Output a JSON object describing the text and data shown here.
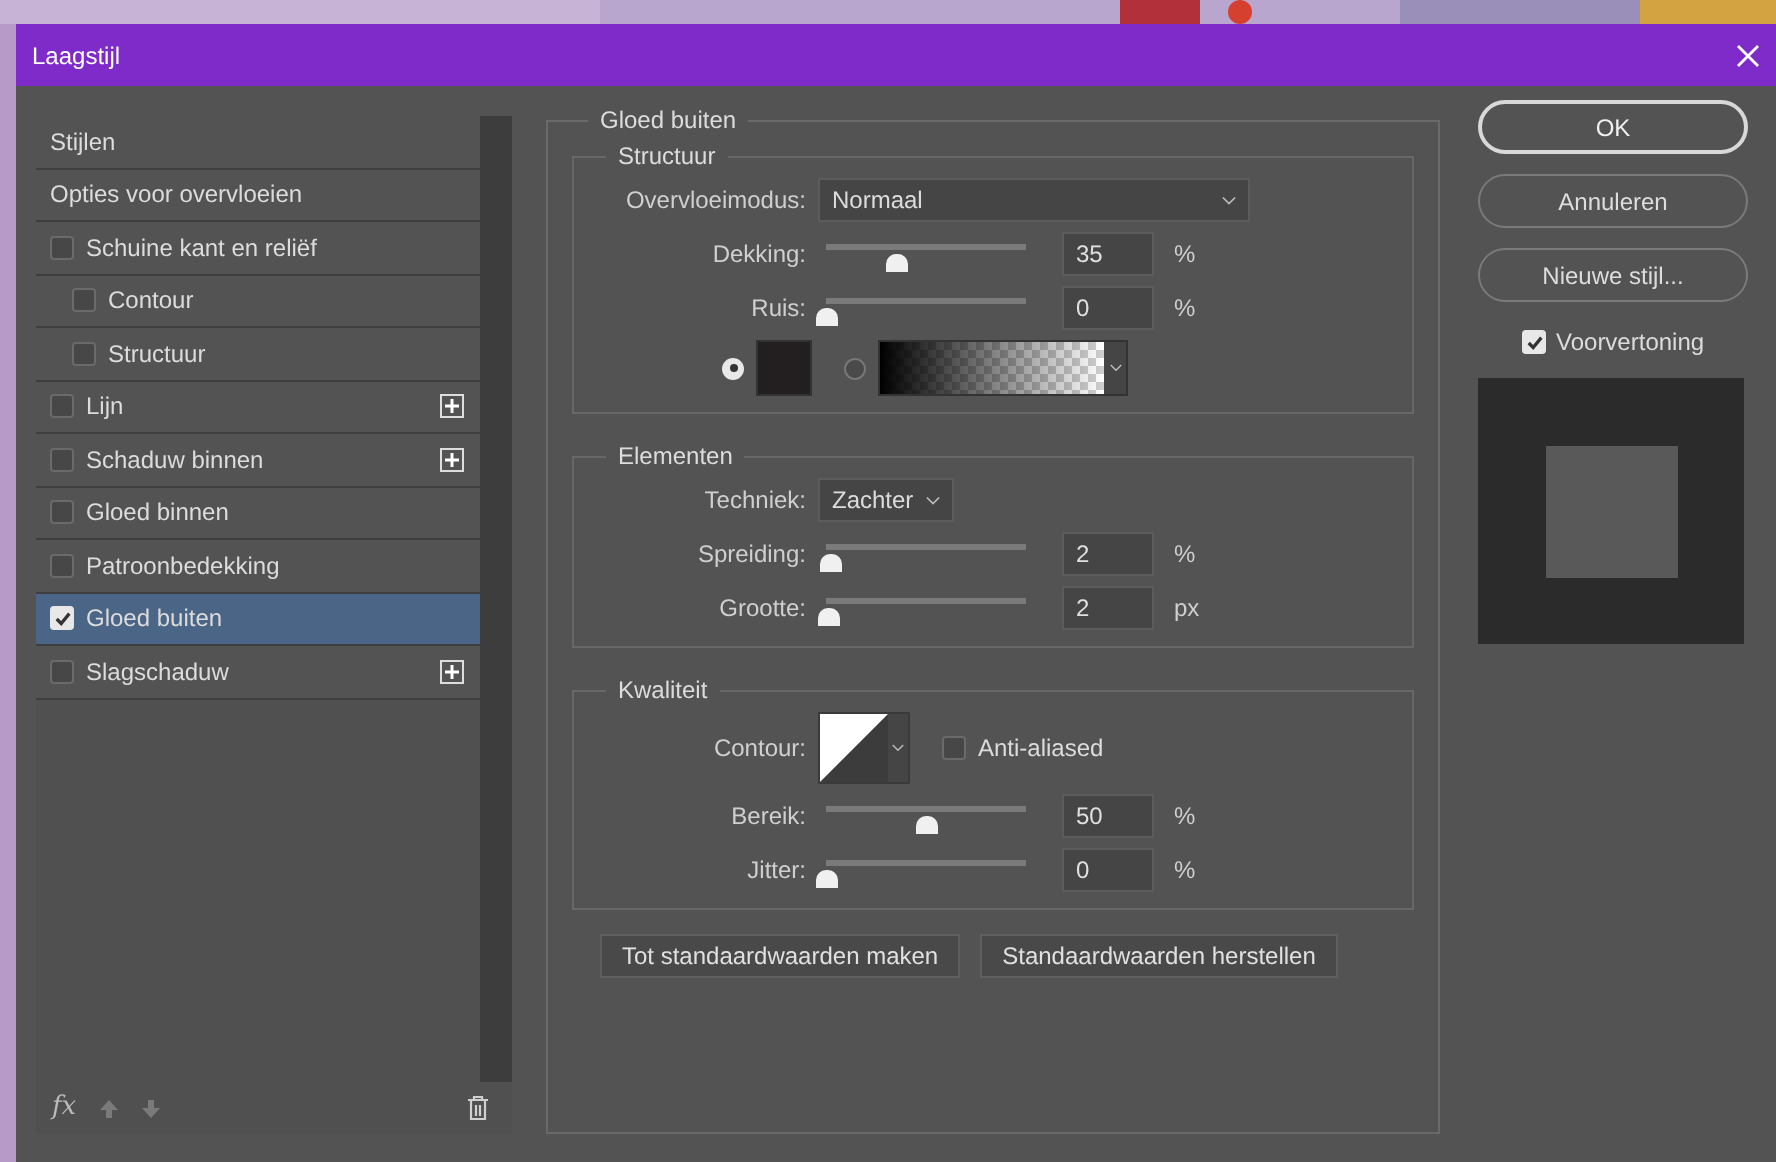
{
  "window": {
    "title": "Laagstijl"
  },
  "sidebar": {
    "items": [
      {
        "label": "Stijlen",
        "kind": "header",
        "selected": false
      },
      {
        "label": "Opties voor overvloeien",
        "kind": "header",
        "selected": false
      },
      {
        "label": "Schuine kant en reliëf",
        "kind": "checkbox",
        "checked": false,
        "selected": false,
        "add_button": false,
        "children": [
          {
            "label": "Contour",
            "kind": "checkbox",
            "checked": false,
            "selected": false,
            "add_button": false
          },
          {
            "label": "Structuur",
            "kind": "checkbox",
            "checked": false,
            "selected": false,
            "add_button": false
          }
        ]
      },
      {
        "label": "Lijn",
        "kind": "checkbox",
        "checked": false,
        "selected": false,
        "add_button": true
      },
      {
        "label": "Schaduw binnen",
        "kind": "checkbox",
        "checked": false,
        "selected": false,
        "add_button": true
      },
      {
        "label": "Gloed binnen",
        "kind": "checkbox",
        "checked": false,
        "selected": false,
        "add_button": false
      },
      {
        "label": "Patroonbedekking",
        "kind": "checkbox",
        "checked": false,
        "selected": false,
        "add_button": false
      },
      {
        "label": "Gloed buiten",
        "kind": "checkbox",
        "checked": true,
        "selected": true,
        "add_button": false
      },
      {
        "label": "Slagschaduw",
        "kind": "checkbox",
        "checked": false,
        "selected": false,
        "add_button": true
      }
    ],
    "footer_label": "fx"
  },
  "effect": {
    "title": "Gloed buiten",
    "sections": [
      {
        "title": "Structuur",
        "rows": [
          {
            "kind": "dropdown",
            "label": "Overvloeimodus:",
            "value": "Normaal"
          },
          {
            "kind": "slider",
            "label": "Dekking:",
            "level": 0.35,
            "value": "35",
            "unit": "%"
          },
          {
            "kind": "slider",
            "label": "Ruis:",
            "level": 0,
            "value": "0",
            "unit": "%"
          },
          {
            "kind": "fill",
            "options": [
              {
                "kind": "color",
                "selected": true,
                "color": "#231f20"
              },
              {
                "kind": "gradient",
                "selected": false
              }
            ]
          }
        ]
      },
      {
        "title": "Elementen",
        "rows": [
          {
            "kind": "dropdown",
            "label": "Techniek:",
            "value": "Zachter"
          },
          {
            "kind": "slider",
            "label": "Spreiding:",
            "level": 0.02,
            "value": "2",
            "unit": "%"
          },
          {
            "kind": "slider",
            "label": "Grootte:",
            "level": 0.01,
            "value": "2",
            "unit": "px"
          }
        ]
      },
      {
        "title": "Kwaliteit",
        "rows": [
          {
            "kind": "contour",
            "label": "Contour:",
            "checkbox": {
              "label": "Anti-aliased",
              "checked": false
            }
          },
          {
            "kind": "slider",
            "label": "Bereik:",
            "level": 0.5,
            "value": "50",
            "unit": "%"
          },
          {
            "kind": "slider",
            "label": "Jitter:",
            "level": 0,
            "value": "0",
            "unit": "%"
          }
        ]
      }
    ],
    "buttons": [
      "Tot standaardwaarden maken",
      "Standaardwaarden herstellen"
    ]
  },
  "actions": {
    "buttons": [
      {
        "label": "OK",
        "default": true
      },
      {
        "label": "Annuleren",
        "default": false
      },
      {
        "label": "Nieuwe stijl...",
        "default": false
      }
    ],
    "preview": {
      "label": "Voorvertoning",
      "checked": true
    }
  }
}
